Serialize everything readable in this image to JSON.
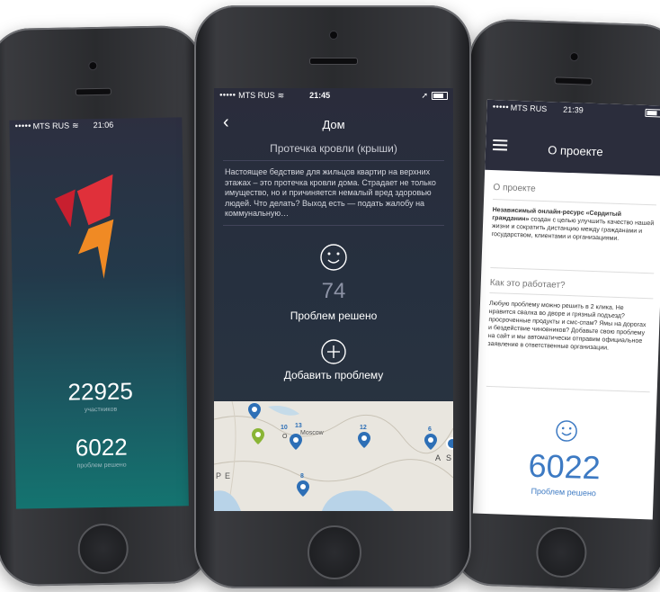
{
  "left_phone": {
    "status": {
      "carrier": "MTS RUS",
      "time": "21:06"
    },
    "participants_count": "22925",
    "participants_label": "участников",
    "solved_count": "6022",
    "solved_label": "проблем решено"
  },
  "center_phone": {
    "status": {
      "carrier": "MTS RUS",
      "time": "21:45"
    },
    "nav": {
      "back_icon": "chevron-left-icon",
      "title": "Дом"
    },
    "subtitle": "Протечка кровли (крыши)",
    "description": "Настоящее бедствие для жильцов квартир на верхних этажах – это протечка кровли дома. Страдает не только имущество, но и причиняется немалый вред здоровью людей. Что делать? Выход есть — подать жалобу на коммунальную…",
    "solved_number": "74",
    "solved_label": "Проблем решено",
    "add_label": "Добавить проблему",
    "map": {
      "pin_labels": [
        "10",
        "13",
        "12",
        "6",
        "8"
      ],
      "text_moscow": "Moscow",
      "text_o": "O",
      "text_p": "P",
      "text_e": "E",
      "text_a": "A",
      "text_s": "S"
    }
  },
  "right_phone": {
    "status": {
      "carrier": "MTS RUS",
      "time": "21:39"
    },
    "nav": {
      "menu_icon": "hamburger-menu-icon",
      "title": "О проекте"
    },
    "section1_title": "О проекте",
    "section1_bold": "Независимый онлайн-ресурс «Сердитый гражданин»",
    "section1_text": " создан с целью улучшить качество нашей жизни и сократить дистанцию между гражданами и государством, клиентами и организациями.",
    "section2_title": "Как это работает?",
    "section2_text": "Любую проблему можно решить в 2 клика. Не нравится свалка во дворе и грязный подъезд? просроченные продукты и смс-спам? Ямы на дорогах и бездействие чиновников? Добавьте свою проблему на сайт и мы автоматически отправим официальное заявление в ответственные организации.",
    "solved_number": "6022",
    "solved_label": "Проблем решено"
  },
  "colors": {
    "teal_top": "#2c2f3f",
    "teal_bottom": "#17706f",
    "navy": "#2b2d3c",
    "accent_blue": "#3d7ac3",
    "logo_red": "#e0303a",
    "logo_orange": "#f08a24"
  }
}
